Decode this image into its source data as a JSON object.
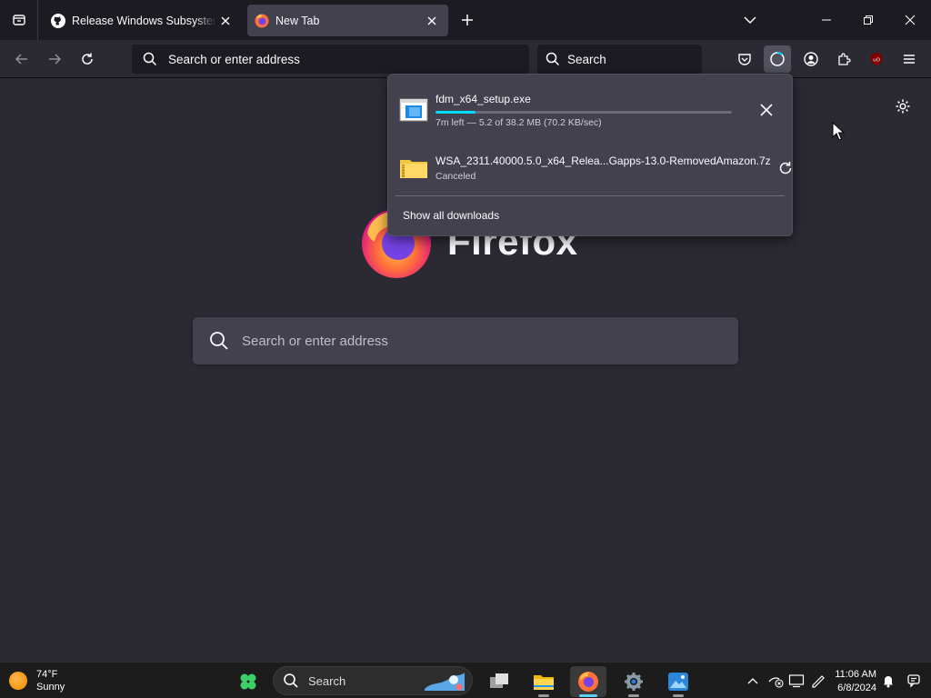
{
  "tabs": [
    {
      "title": "Release Windows Subsystem For Android",
      "favicon": "github-icon",
      "active": false
    },
    {
      "title": "New Tab",
      "favicon": "firefox-icon",
      "active": true
    }
  ],
  "navbar": {
    "url_placeholder": "Search or enter address",
    "search_placeholder": "Search"
  },
  "newtab": {
    "wordmark": "Firefox",
    "search_placeholder": "Search or enter address"
  },
  "downloads": {
    "items": [
      {
        "name": "fdm_x64_setup.exe",
        "status": "7m left — 5.2 of 38.2 MB (70.2 KB/sec)",
        "progress": 0.136,
        "icon": "exe-file-icon",
        "action": "cancel-icon"
      },
      {
        "name": "WSA_2311.40000.5.0_x64_Relea...Gapps-13.0-RemovedAmazon.7z",
        "status": "Canceled",
        "icon": "zip-folder-icon",
        "action": "retry-icon"
      }
    ],
    "show_all": "Show all downloads"
  },
  "taskbar": {
    "weather_temp": "74°F",
    "weather_desc": "Sunny",
    "search_label": "Search",
    "time": "11:06 AM",
    "date": "6/8/2024"
  },
  "colors": {
    "accent_progress": "#00ddff",
    "toolbar": "#2b2a33",
    "tabbar": "#1c1b22"
  }
}
